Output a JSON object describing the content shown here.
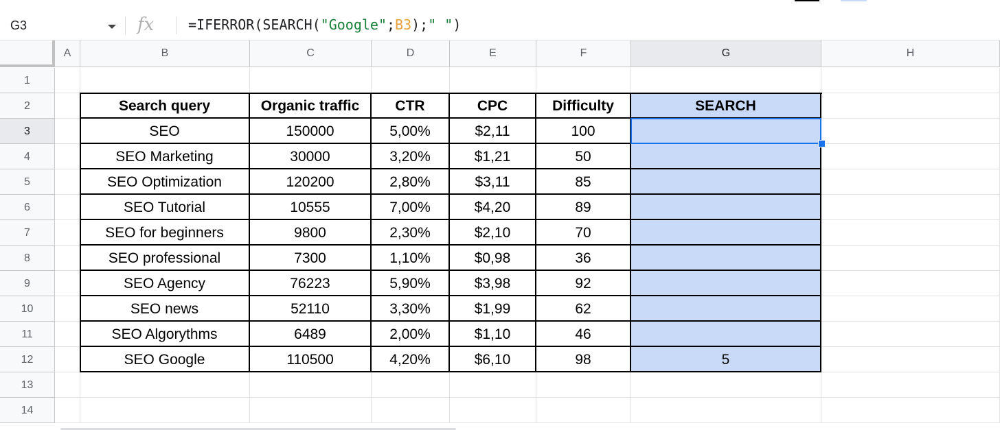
{
  "formula_bar": {
    "name_box": "G3",
    "fx_label": "fx",
    "formula_parts": [
      {
        "text": "=IFERROR(SEARCH(",
        "kind": "plain"
      },
      {
        "text": "\"Google\"",
        "kind": "string"
      },
      {
        "text": ";",
        "kind": "plain"
      },
      {
        "text": "B3",
        "kind": "ref"
      },
      {
        "text": ");",
        "kind": "plain"
      },
      {
        "text": "\" \"",
        "kind": "string"
      },
      {
        "text": ")",
        "kind": "plain"
      }
    ]
  },
  "columns": [
    "A",
    "B",
    "C",
    "D",
    "E",
    "F",
    "G",
    "H"
  ],
  "rows": [
    "1",
    "2",
    "3",
    "4",
    "5",
    "6",
    "7",
    "8",
    "9",
    "10",
    "11",
    "12",
    "13",
    "14"
  ],
  "selected_cell": "G3",
  "table": {
    "headers": [
      "Search query",
      "Organic traffic",
      "CTR",
      "CPC",
      "Difficulty",
      "SEARCH"
    ],
    "rows": [
      [
        "SEO",
        "150000",
        "5,00%",
        "$2,11",
        "100",
        ""
      ],
      [
        "SEO Marketing",
        "30000",
        "3,20%",
        "$1,21",
        "50",
        ""
      ],
      [
        "SEO Optimization",
        "120200",
        "2,80%",
        "$3,11",
        "85",
        ""
      ],
      [
        "SEO Tutorial",
        "10555",
        "7,00%",
        "$4,20",
        "89",
        ""
      ],
      [
        "SEO for beginners",
        "9800",
        "2,30%",
        "$2,10",
        "70",
        ""
      ],
      [
        "SEO professional",
        "7300",
        "1,10%",
        "$0,98",
        "36",
        ""
      ],
      [
        "SEO Agency",
        "76223",
        "5,90%",
        "$3,98",
        "92",
        ""
      ],
      [
        "SEO news",
        "52110",
        "3,30%",
        "$1,99",
        "62",
        ""
      ],
      [
        "SEO Algorythms",
        "6489",
        "2,00%",
        "$1,10",
        "46",
        ""
      ],
      [
        "SEO Google",
        "110500",
        "4,20%",
        "$6,10",
        "98",
        "5"
      ]
    ]
  },
  "colors": {
    "highlight_column": "#c9daf8",
    "selection": "#1a73e8",
    "formula_string": "#188038",
    "formula_ref": "#e8a13c"
  }
}
